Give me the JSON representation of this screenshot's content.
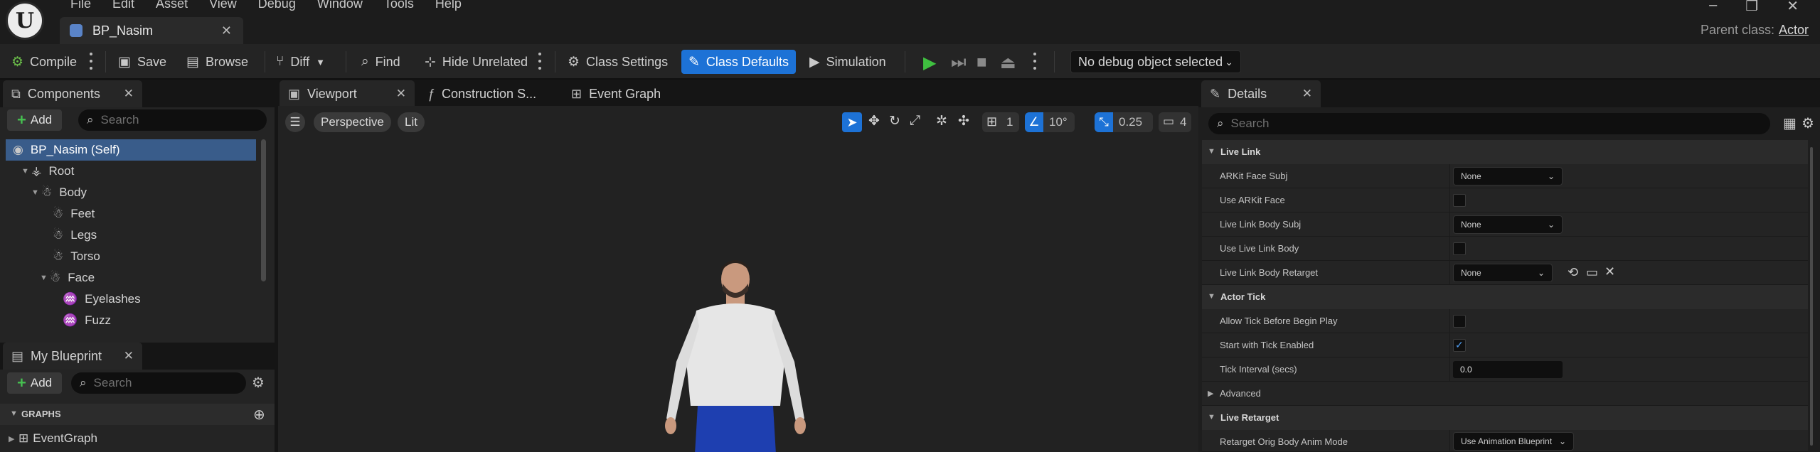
{
  "app": {
    "logo_letter": "U",
    "menu": [
      "File",
      "Edit",
      "Asset",
      "View",
      "Debug",
      "Window",
      "Tools",
      "Help"
    ],
    "tab_title": "BP_Nasim",
    "parent_class_label": "Parent class:",
    "parent_class_value": "Actor"
  },
  "toolbar": {
    "compile": "Compile",
    "save": "Save",
    "browse": "Browse",
    "diff": "Diff",
    "find": "Find",
    "hide_unrelated": "Hide Unrelated",
    "class_settings": "Class Settings",
    "class_defaults": "Class Defaults",
    "simulation": "Simulation",
    "debug_object": "No debug object selected"
  },
  "components": {
    "tab": "Components",
    "add": "Add",
    "search_placeholder": "Search",
    "items": [
      {
        "label": "BP_Nasim (Self)",
        "depth": 0,
        "icon": "blueprint-icon"
      },
      {
        "label": "Root",
        "depth": 1,
        "icon": "root-bone-icon"
      },
      {
        "label": "Body",
        "depth": 2,
        "icon": "skeletal-mesh-icon"
      },
      {
        "label": "Feet",
        "depth": 3,
        "icon": "skeletal-mesh-icon"
      },
      {
        "label": "Legs",
        "depth": 3,
        "icon": "skeletal-mesh-icon"
      },
      {
        "label": "Torso",
        "depth": 3,
        "icon": "skeletal-mesh-icon"
      },
      {
        "label": "Face",
        "depth": 3,
        "icon": "skeletal-mesh-icon"
      },
      {
        "label": "Eyelashes",
        "depth": 4,
        "icon": "groom-icon"
      },
      {
        "label": "Fuzz",
        "depth": 4,
        "icon": "groom-icon"
      }
    ]
  },
  "my_blueprint": {
    "tab": "My Blueprint",
    "add": "Add",
    "search_placeholder": "Search",
    "graphs_header": "GRAPHS",
    "graph_item": "EventGraph"
  },
  "editor_tabs": {
    "viewport": "Viewport",
    "construction": "Construction S...",
    "event_graph": "Event Graph"
  },
  "viewport": {
    "perspective": "Perspective",
    "lit": "Lit",
    "grid_value": "1",
    "angle_value": "10°",
    "scale_value": "0.25",
    "camera_speed": "4"
  },
  "details": {
    "tab": "Details",
    "search_placeholder": "Search",
    "categories": {
      "live_link": "Live Link",
      "actor_tick": "Actor Tick",
      "advanced": "Advanced",
      "live_retarget": "Live Retarget"
    },
    "rows": {
      "arkit_face_subj": "ARKit Face Subj",
      "arkit_face_subj_value": "None",
      "use_arkit_face": "Use ARKit Face",
      "live_link_body_subj": "Live Link Body Subj",
      "live_link_body_subj_value": "None",
      "use_live_link_body": "Use Live Link Body",
      "live_link_body_retarget": "Live Link Body Retarget",
      "live_link_body_retarget_value": "None",
      "allow_tick_before_begin_play": "Allow Tick Before Begin Play",
      "start_with_tick_enabled": "Start with Tick Enabled",
      "tick_interval": "Tick Interval (secs)",
      "tick_interval_value": "0.0",
      "retarget_orig_body_anim_mode": "Retarget Orig Body Anim Mode",
      "retarget_orig_body_anim_mode_value": "Use Animation Blueprint"
    },
    "checkboxes": {
      "use_arkit_face": false,
      "use_live_link_body": false,
      "allow_tick_before_begin_play": false,
      "start_with_tick_enabled": true
    }
  },
  "colors": {
    "accent": "#1d72d6",
    "selection": "#395c8a",
    "play_green": "#3fc040"
  }
}
